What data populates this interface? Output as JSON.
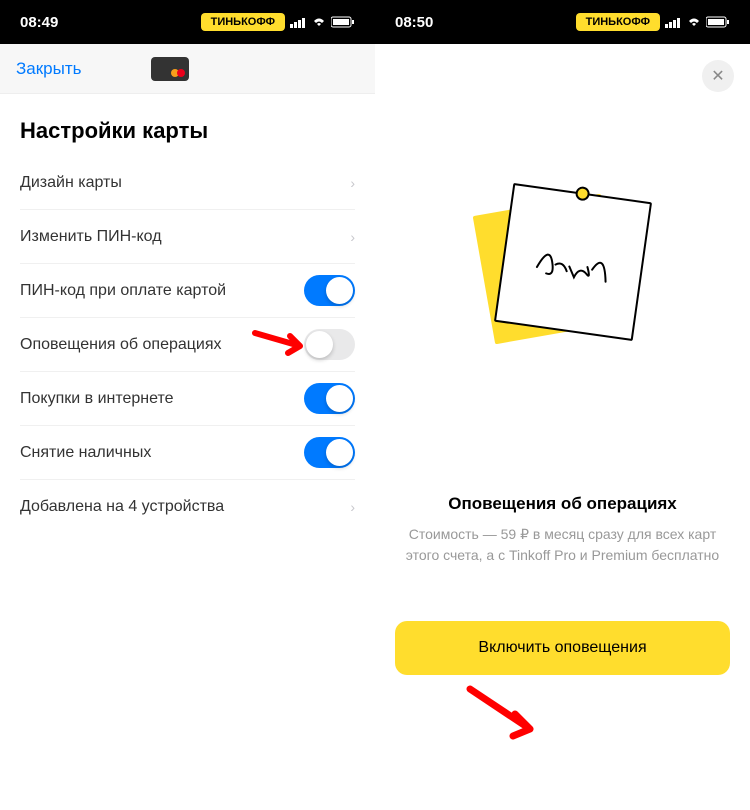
{
  "left": {
    "statusTime": "08:49",
    "brand": "ТИНЬКОФФ",
    "closeLabel": "Закрыть",
    "sectionTitle": "Настройки карты",
    "items": [
      {
        "label": "Дизайн карты",
        "type": "nav"
      },
      {
        "label": "Изменить ПИН-код",
        "type": "nav"
      },
      {
        "label": "ПИН-код при оплате картой",
        "type": "toggle",
        "on": true
      },
      {
        "label": "Оповещения об операциях",
        "type": "toggle",
        "on": false
      },
      {
        "label": "Покупки в интернете",
        "type": "toggle",
        "on": true
      },
      {
        "label": "Снятие наличных",
        "type": "toggle",
        "on": true
      },
      {
        "label": "Добавлена на 4 устройства",
        "type": "nav"
      }
    ]
  },
  "right": {
    "statusTime": "08:50",
    "brand": "ТИНЬКОФФ",
    "promoTitle": "Оповещения об операциях",
    "promoDesc": "Стоимость — 59 ₽ в месяц сразу для всех карт этого счета, а с Tinkoff Pro и Premium бесплатно",
    "ctaLabel": "Включить оповещения"
  }
}
